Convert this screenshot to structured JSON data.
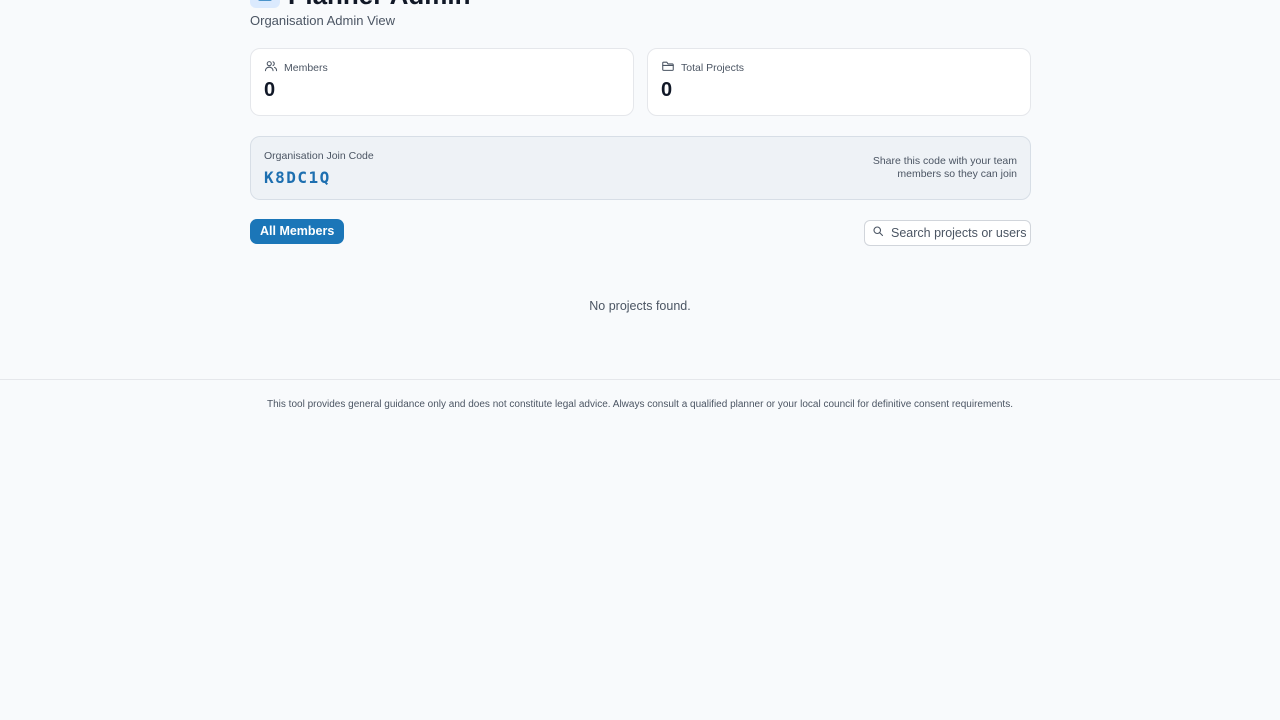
{
  "header": {
    "title": "Planner Admin",
    "subtitle": "Organisation Admin View"
  },
  "stats": {
    "members": {
      "label": "Members",
      "value": "0",
      "icon": "users-icon"
    },
    "projects": {
      "label": "Total Projects",
      "value": "0",
      "icon": "folder-icon"
    }
  },
  "join": {
    "label": "Organisation Join Code",
    "code": "K8DC1Q",
    "hint": "Share this code with your team members so they can join"
  },
  "toolbar": {
    "tab_label": "All Members",
    "search_placeholder": "Search projects or users"
  },
  "content": {
    "empty_message": "No projects found."
  },
  "footer": {
    "disclaimer": "This tool provides general guidance only and does not constitute legal advice. Always consult a qualified planner or your local council for definitive consent requirements."
  },
  "colors": {
    "accent": "#1b76b8",
    "join_code": "#1d6fb0",
    "background": "#f8fafc"
  }
}
